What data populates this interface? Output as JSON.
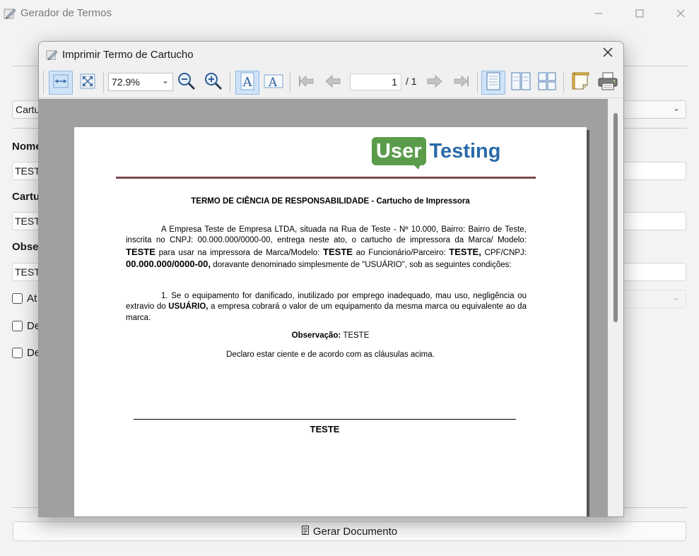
{
  "main_window": {
    "title": "Gerador de Termos",
    "type_select_value": "Cartu",
    "labels": {
      "nome": "Nome",
      "cartucho": "Cartu",
      "observacao": "Obser"
    },
    "inputs": {
      "nome": "TESTE",
      "cartucho": "TESTE",
      "observacao": "TESTE"
    },
    "checkboxes": [
      {
        "label": "At"
      },
      {
        "label": "De"
      },
      {
        "label": "De"
      }
    ],
    "generate_button": "Gerar Documento"
  },
  "dialog": {
    "title": "Imprimir Termo de Cartucho",
    "toolbar": {
      "zoom": "72.9%",
      "page_current": "1",
      "page_total": "/ 1"
    }
  },
  "document": {
    "logo_user": "User",
    "logo_testing": "Testing",
    "heading": "TERMO DE CIÊNCIA DE RESPONSABILIDADE - Cartucho de Impressora",
    "p1_a": "A Empresa Teste de Empresa LTDA, situada na Rua de Teste - Nº 10.000, Bairro: Bairro de Teste, inscrita no CNPJ: 00.000.000/0000-00, entrega neste ato, o cartucho de impressora da Marca/ Modelo:",
    "p1_model": "TESTE",
    "p1_b": "para usar na impressora de Marca/Modelo:",
    "p1_printer": "TESTE",
    "p1_c": "ao Funcionário/Parceiro:",
    "p1_employee": "TESTE,",
    "p1_d": "CPF/CNPJ:",
    "p1_cpf": "00.000.000/0000-00,",
    "p1_e": "doravante denominado simplesmente de \"USUÁRIO\", sob as seguintes condições:",
    "p2_a": "1. Se o equipamento for danificado, inutilizado por emprego inadequado, mau uso, negligência ou extravio do",
    "p2_user": "USUÁRIO,",
    "p2_b": "a empresa cobrará o valor de um equipamento da mesma marca ou equivalente ao da marca.",
    "obs_label": "Observação:",
    "obs_value": "TESTE",
    "declaration": "Declaro estar ciente e de acordo com as cláusulas acima.",
    "signature_name": "TESTE"
  }
}
